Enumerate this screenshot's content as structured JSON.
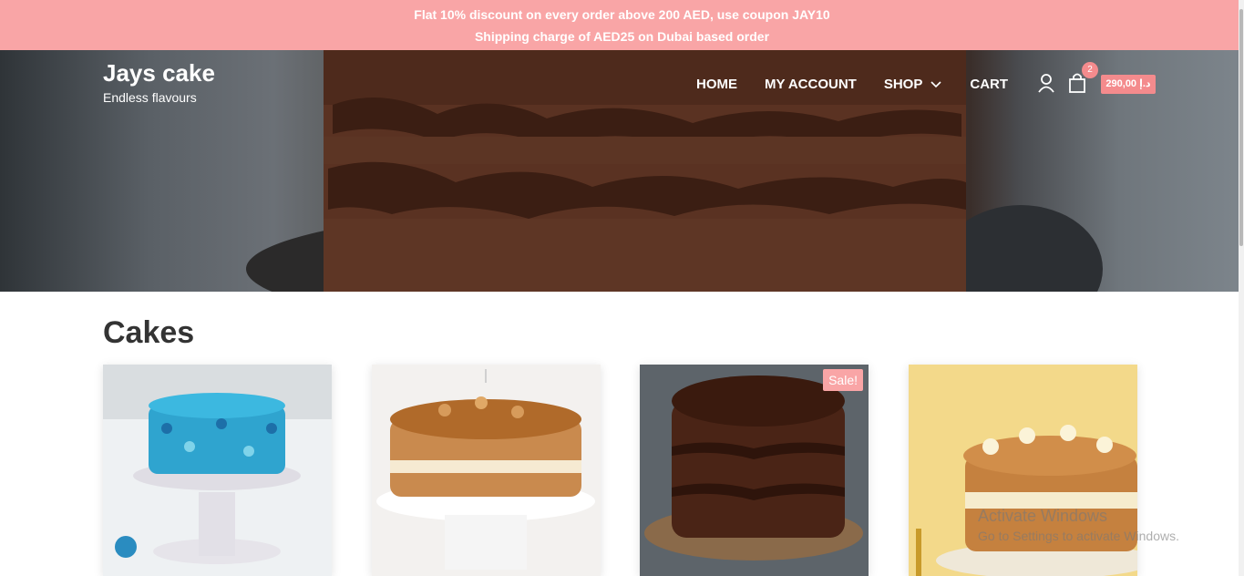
{
  "promo": {
    "line1": "Flat 10% discount on every order above 200 AED, use coupon JAY10",
    "line2": "Shipping charge of AED25 on Dubai based order"
  },
  "site": {
    "title": "Jays cake",
    "tagline": "Endless flavours"
  },
  "nav": {
    "home": "HOME",
    "account": "MY ACCOUNT",
    "shop": "SHOP",
    "cart": "CART"
  },
  "cart": {
    "count": "2",
    "total": "290,00 د.إ"
  },
  "main": {
    "section_title": "Cakes"
  },
  "products": [
    {
      "name": "blue-flower-cake"
    },
    {
      "name": "caramel-cake"
    },
    {
      "name": "chocolate-cake",
      "badge": "Sale!"
    },
    {
      "name": "cream-cake"
    }
  ],
  "watermark": {
    "line1": "Activate Windows",
    "line2": "Go to Settings to activate Windows."
  },
  "colors": {
    "promo_bg": "#f9a5a6",
    "accent": "#f48b8d"
  }
}
